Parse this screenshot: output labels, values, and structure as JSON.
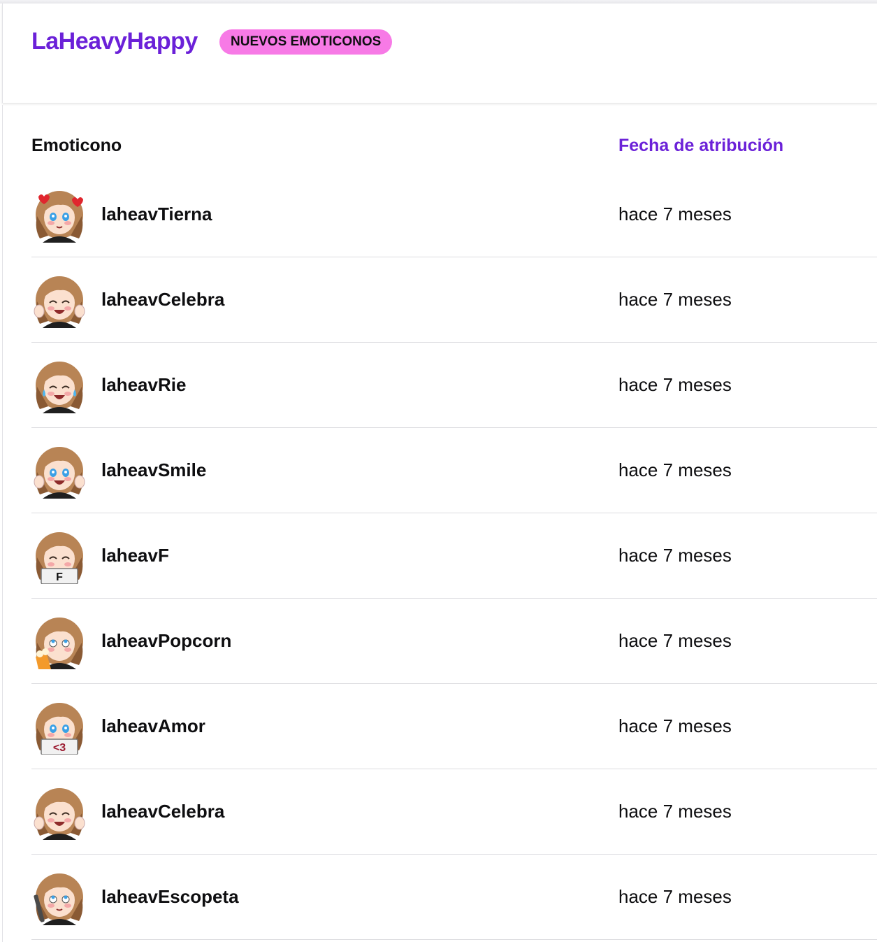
{
  "header": {
    "channel_name": "LaHeavyHappy",
    "badge": "NUEVOS EMOTICONOS"
  },
  "table": {
    "columns": {
      "emote": "Emoticono",
      "date": "Fecha de atribución"
    },
    "rows": [
      {
        "name": "laheavTierna",
        "date": "hace 7 meses",
        "icon": "tierna-emote-icon"
      },
      {
        "name": "laheavCelebra",
        "date": "hace 7 meses",
        "icon": "celebra-emote-icon"
      },
      {
        "name": "laheavRie",
        "date": "hace 7 meses",
        "icon": "rie-emote-icon"
      },
      {
        "name": "laheavSmile",
        "date": "hace 7 meses",
        "icon": "smile-emote-icon"
      },
      {
        "name": "laheavF",
        "date": "hace 7 meses",
        "icon": "f-emote-icon",
        "sign_text": "F"
      },
      {
        "name": "laheavPopcorn",
        "date": "hace 7 meses",
        "icon": "popcorn-emote-icon"
      },
      {
        "name": "laheavAmor",
        "date": "hace 7 meses",
        "icon": "amor-emote-icon",
        "sign_text": "<3"
      },
      {
        "name": "laheavCelebra",
        "date": "hace 7 meses",
        "icon": "celebra-emote-icon"
      },
      {
        "name": "laheavEscopeta",
        "date": "hace 7 meses",
        "icon": "escopeta-emote-icon"
      }
    ]
  },
  "colors": {
    "accent": "#6b21d8",
    "badge": "#f77ae6",
    "text": "#0e0e10",
    "divider": "#dcdce0"
  }
}
